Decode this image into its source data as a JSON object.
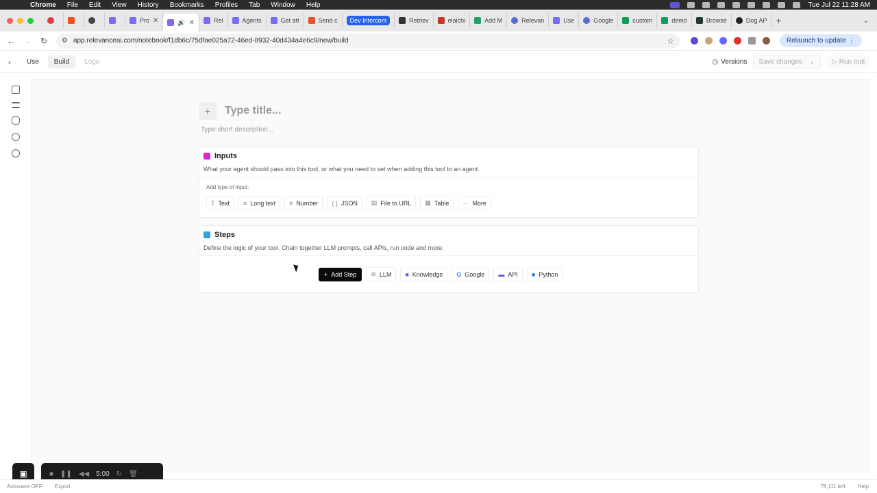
{
  "menubar": {
    "app": "Chrome",
    "menus": [
      "File",
      "Edit",
      "View",
      "History",
      "Bookmarks",
      "Profiles",
      "Tab",
      "Window",
      "Help"
    ],
    "clock": "Tue Jul 22  11:28 AM"
  },
  "tabs": [
    {
      "label": ""
    },
    {
      "label": ""
    },
    {
      "label": "Pro"
    },
    {
      "label": "",
      "active": true
    },
    {
      "label": "Rel"
    },
    {
      "label": "Agents"
    },
    {
      "label": "Get att"
    },
    {
      "label": "Send c"
    },
    {
      "label": "Dev Intercom",
      "pill": true
    },
    {
      "label": "Retriev"
    },
    {
      "label": "elaichi"
    },
    {
      "label": "Add M"
    },
    {
      "label": "Relevan"
    },
    {
      "label": "Use"
    },
    {
      "label": "Google"
    },
    {
      "label": "custom"
    },
    {
      "label": "demo"
    },
    {
      "label": "Browse"
    },
    {
      "label": "Dog AP"
    }
  ],
  "address": {
    "url": "app.relevanceai.com/notebook/f1db6c/75dfae025a72-46ed-8932-40d434a4e6c9/new/build",
    "relaunch": "Relaunch to update"
  },
  "toolbar": {
    "tabs": [
      "Use",
      "Build",
      "Logs"
    ],
    "versions": "Versions",
    "save_changes": "Save changes",
    "run_tool": "Run tool"
  },
  "editor": {
    "title_placeholder": "Type title...",
    "description_placeholder": "Type short description..."
  },
  "inputs_card": {
    "title": "Inputs",
    "subtitle": "What your agent should pass into this tool, or what you need to set when adding this tool to an agent.",
    "add_label": "Add type of input:",
    "types": [
      "Text",
      "Long text",
      "Number",
      "JSON",
      "File to URL",
      "Table",
      "More"
    ]
  },
  "steps_card": {
    "title": "Steps",
    "subtitle": "Define the logic of your tool. Chain together LLM prompts, call APIs, run code and more.",
    "add_step": "Add Step",
    "quick": [
      "LLM",
      "Knowledge",
      "Google",
      "API",
      "Python"
    ]
  },
  "recorder": {
    "timer": "5:00"
  },
  "footer": {
    "autosave": "Autosave OFF",
    "export": "Export",
    "credits": "78,111 left",
    "help": "Help"
  }
}
